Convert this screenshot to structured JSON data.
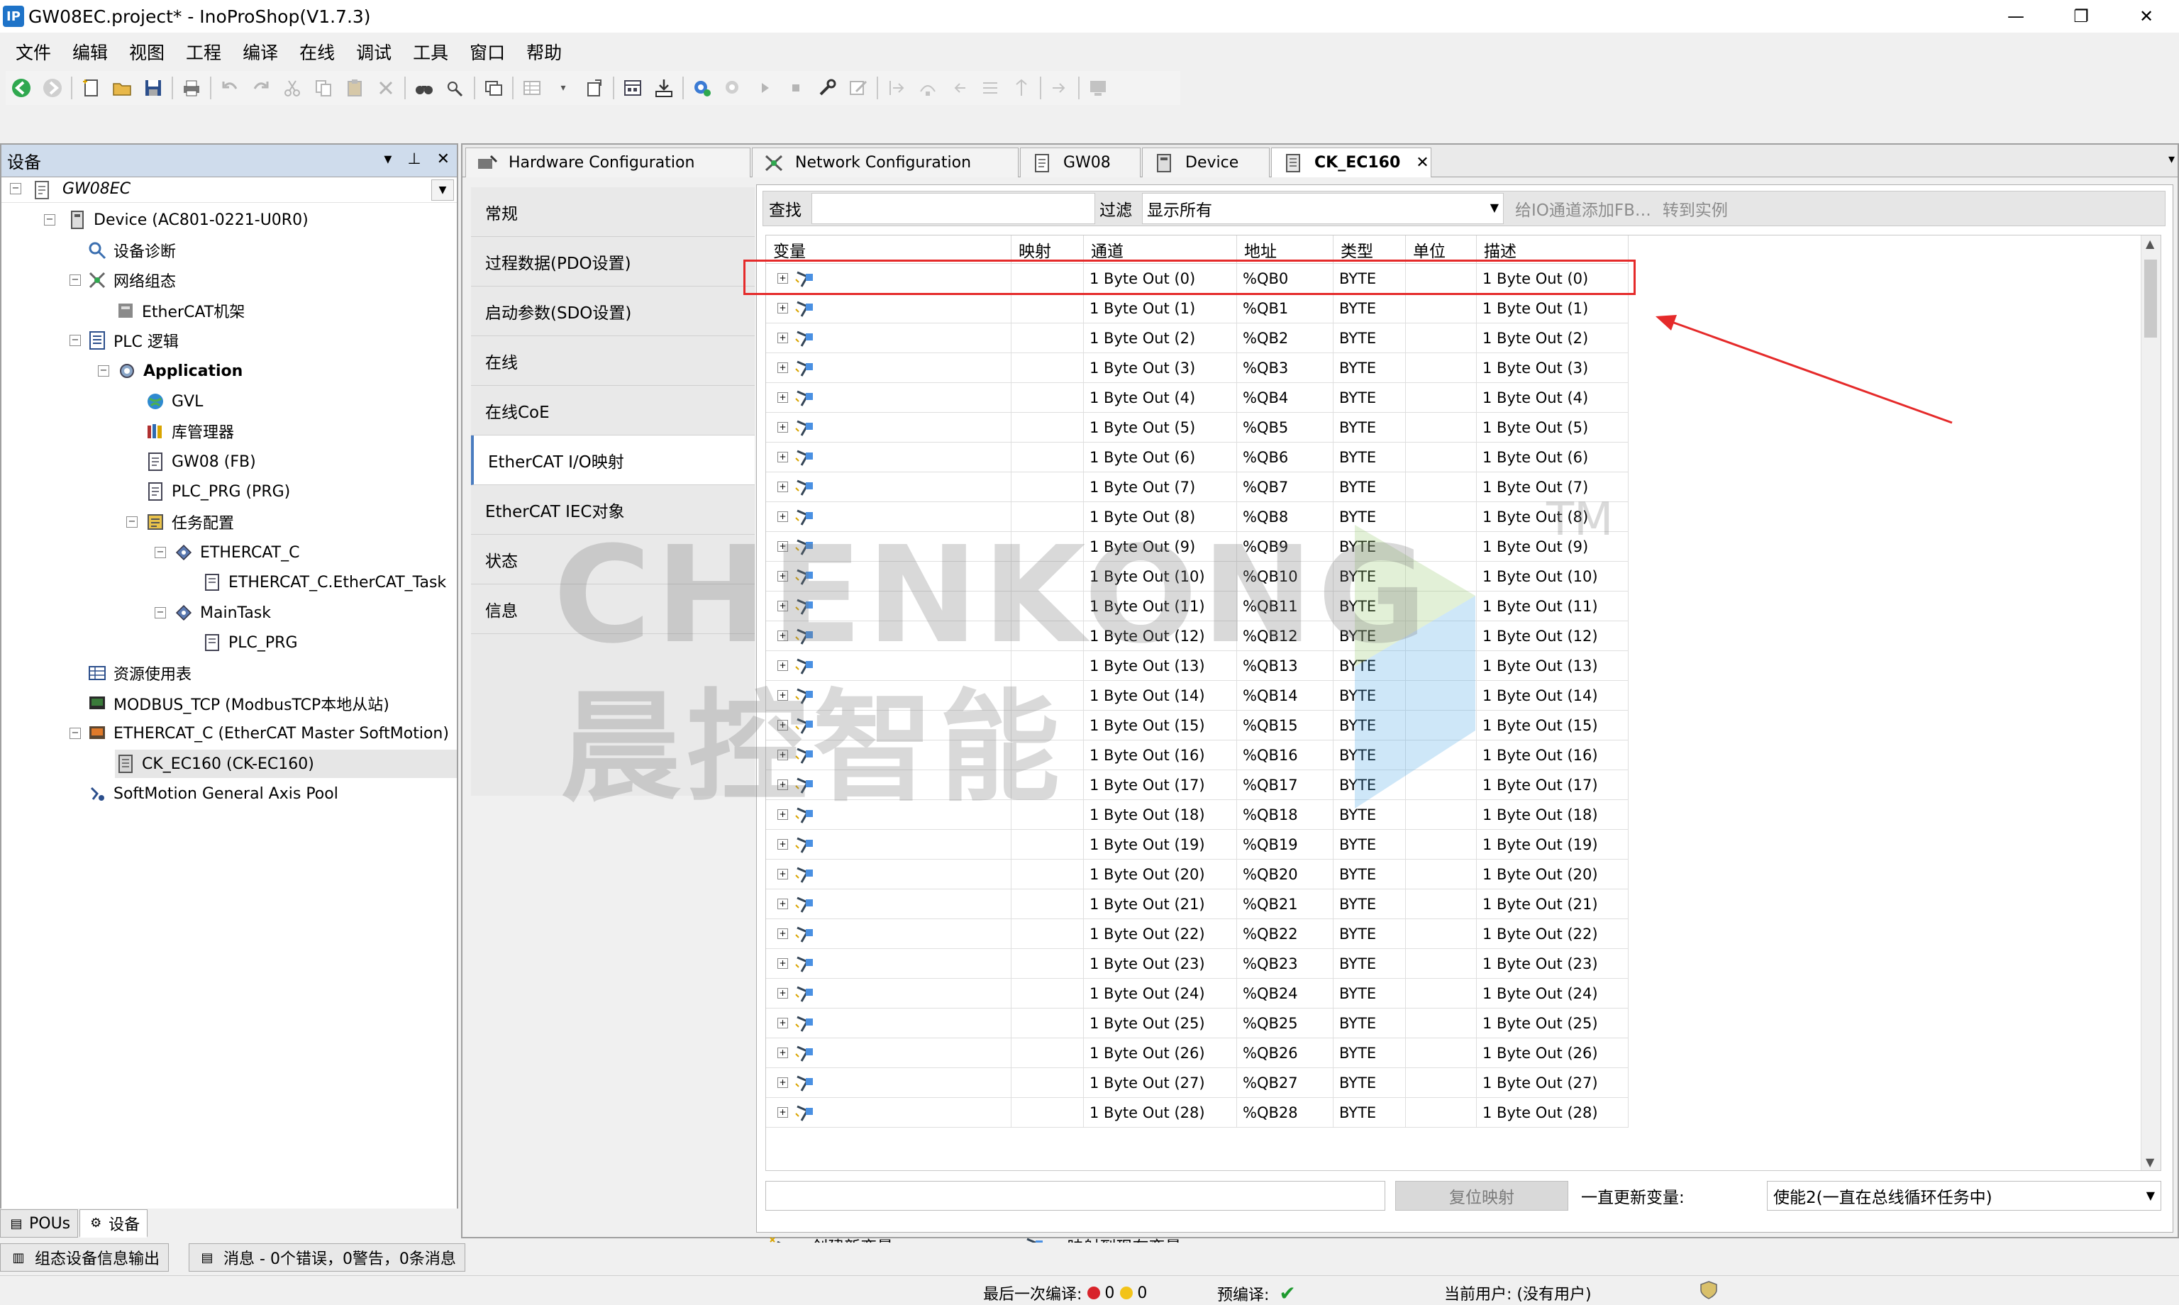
{
  "window": {
    "title": "GW08EC.project* - InoProShop(V1.7.3)",
    "app_icon_text": "IP",
    "controls": {
      "minimize": "—",
      "maximize": "❐",
      "close": "✕"
    }
  },
  "menubar": [
    "文件",
    "编辑",
    "视图",
    "工程",
    "编译",
    "在线",
    "调试",
    "工具",
    "窗口",
    "帮助"
  ],
  "left_panel": {
    "title": "设备",
    "controls": {
      "dropdown": "▾",
      "pin": "⊥",
      "close": "✕"
    },
    "root_label": "GW08EC",
    "tree": [
      {
        "label": "Device (AC801-0221-U0R0)",
        "icon": "device-icon"
      },
      {
        "label": "设备诊断",
        "icon": "diagnostics-icon"
      },
      {
        "label": "网络组态",
        "icon": "network-config-icon"
      },
      {
        "label": "EtherCAT机架",
        "icon": "rack-icon"
      },
      {
        "label": "PLC 逻辑",
        "icon": "plc-logic-icon"
      },
      {
        "label": "Application",
        "icon": "application-gear-icon"
      },
      {
        "label": "GVL",
        "icon": "globe-icon"
      },
      {
        "label": "库管理器",
        "icon": "library-icon"
      },
      {
        "label": "GW08 (FB)",
        "icon": "document-icon"
      },
      {
        "label": "PLC_PRG (PRG)",
        "icon": "document-icon"
      },
      {
        "label": "任务配置",
        "icon": "task-config-icon"
      },
      {
        "label": "ETHERCAT_C",
        "icon": "task-icon"
      },
      {
        "label": "ETHERCAT_C.EtherCAT_Task",
        "icon": "task-item-icon"
      },
      {
        "label": "MainTask",
        "icon": "task-icon"
      },
      {
        "label": "PLC_PRG",
        "icon": "task-item-icon"
      },
      {
        "label": "资源使用表",
        "icon": "table-icon"
      },
      {
        "label": "MODBUS_TCP (ModbusTCP本地从站)",
        "icon": "modbus-icon"
      },
      {
        "label": "ETHERCAT_C (EtherCAT Master SoftMotion)",
        "icon": "ethercat-master-icon"
      },
      {
        "label": "CK_EC160 (CK-EC160)",
        "icon": "module-icon"
      },
      {
        "label": "SoftMotion General Axis Pool",
        "icon": "axis-pool-icon"
      }
    ],
    "bottom_tabs": [
      "POUs",
      "设备"
    ]
  },
  "editor": {
    "tabs": [
      {
        "label": "Hardware Configuration",
        "icon": "hardware-icon"
      },
      {
        "label": "Network Configuration",
        "icon": "network-icon"
      },
      {
        "label": "GW08",
        "icon": "doc-icon"
      },
      {
        "label": "Device",
        "icon": "device-icon"
      },
      {
        "label": "CK_EC160",
        "icon": "module-icon",
        "close": "✕"
      }
    ],
    "tab_dropdown": "▾",
    "side_nav": [
      "常规",
      "过程数据(PDO设置)",
      "启动参数(SDO设置)",
      "在线",
      "在线CoE",
      "EtherCAT I/O映射",
      "EtherCAT IEC对象",
      "状态",
      "信息"
    ],
    "side_nav_active": "EtherCAT I/O映射",
    "filter": {
      "find_label": "查找",
      "filter_label": "过滤",
      "filter_value": "显示所有",
      "add_fb": "给IO通道添加FB…",
      "goto_instance": "转到实例"
    },
    "columns": [
      "变量",
      "映射",
      "通道",
      "地址",
      "类型",
      "单位",
      "描述"
    ],
    "rows": [
      {
        "channel": "1 Byte Out (0)",
        "address": "%QB0",
        "type": "BYTE",
        "desc": "1 Byte Out (0)"
      },
      {
        "channel": "1 Byte Out (1)",
        "address": "%QB1",
        "type": "BYTE",
        "desc": "1 Byte Out (1)"
      },
      {
        "channel": "1 Byte Out (2)",
        "address": "%QB2",
        "type": "BYTE",
        "desc": "1 Byte Out (2)"
      },
      {
        "channel": "1 Byte Out (3)",
        "address": "%QB3",
        "type": "BYTE",
        "desc": "1 Byte Out (3)"
      },
      {
        "channel": "1 Byte Out (4)",
        "address": "%QB4",
        "type": "BYTE",
        "desc": "1 Byte Out (4)"
      },
      {
        "channel": "1 Byte Out (5)",
        "address": "%QB5",
        "type": "BYTE",
        "desc": "1 Byte Out (5)"
      },
      {
        "channel": "1 Byte Out (6)",
        "address": "%QB6",
        "type": "BYTE",
        "desc": "1 Byte Out (6)"
      },
      {
        "channel": "1 Byte Out (7)",
        "address": "%QB7",
        "type": "BYTE",
        "desc": "1 Byte Out (7)"
      },
      {
        "channel": "1 Byte Out (8)",
        "address": "%QB8",
        "type": "BYTE",
        "desc": "1 Byte Out (8)"
      },
      {
        "channel": "1 Byte Out (9)",
        "address": "%QB9",
        "type": "BYTE",
        "desc": "1 Byte Out (9)"
      },
      {
        "channel": "1 Byte Out (10)",
        "address": "%QB10",
        "type": "BYTE",
        "desc": "1 Byte Out (10)"
      },
      {
        "channel": "1 Byte Out (11)",
        "address": "%QB11",
        "type": "BYTE",
        "desc": "1 Byte Out (11)"
      },
      {
        "channel": "1 Byte Out (12)",
        "address": "%QB12",
        "type": "BYTE",
        "desc": "1 Byte Out (12)"
      },
      {
        "channel": "1 Byte Out (13)",
        "address": "%QB13",
        "type": "BYTE",
        "desc": "1 Byte Out (13)"
      },
      {
        "channel": "1 Byte Out (14)",
        "address": "%QB14",
        "type": "BYTE",
        "desc": "1 Byte Out (14)"
      },
      {
        "channel": "1 Byte Out (15)",
        "address": "%QB15",
        "type": "BYTE",
        "desc": "1 Byte Out (15)"
      },
      {
        "channel": "1 Byte Out (16)",
        "address": "%QB16",
        "type": "BYTE",
        "desc": "1 Byte Out (16)"
      },
      {
        "channel": "1 Byte Out (17)",
        "address": "%QB17",
        "type": "BYTE",
        "desc": "1 Byte Out (17)"
      },
      {
        "channel": "1 Byte Out (18)",
        "address": "%QB18",
        "type": "BYTE",
        "desc": "1 Byte Out (18)"
      },
      {
        "channel": "1 Byte Out (19)",
        "address": "%QB19",
        "type": "BYTE",
        "desc": "1 Byte Out (19)"
      },
      {
        "channel": "1 Byte Out (20)",
        "address": "%QB20",
        "type": "BYTE",
        "desc": "1 Byte Out (20)"
      },
      {
        "channel": "1 Byte Out (21)",
        "address": "%QB21",
        "type": "BYTE",
        "desc": "1 Byte Out (21)"
      },
      {
        "channel": "1 Byte Out (22)",
        "address": "%QB22",
        "type": "BYTE",
        "desc": "1 Byte Out (22)"
      },
      {
        "channel": "1 Byte Out (23)",
        "address": "%QB23",
        "type": "BYTE",
        "desc": "1 Byte Out (23)"
      },
      {
        "channel": "1 Byte Out (24)",
        "address": "%QB24",
        "type": "BYTE",
        "desc": "1 Byte Out (24)"
      },
      {
        "channel": "1 Byte Out (25)",
        "address": "%QB25",
        "type": "BYTE",
        "desc": "1 Byte Out (25)"
      },
      {
        "channel": "1 Byte Out (26)",
        "address": "%QB26",
        "type": "BYTE",
        "desc": "1 Byte Out (26)"
      },
      {
        "channel": "1 Byte Out (27)",
        "address": "%QB27",
        "type": "BYTE",
        "desc": "1 Byte Out (27)"
      },
      {
        "channel": "1 Byte Out (28)",
        "address": "%QB28",
        "type": "BYTE",
        "desc": "1 Byte Out (28)"
      }
    ],
    "bottom": {
      "reset_mapping": "复位映射",
      "always_update_label": "一直更新变量:",
      "always_update_value": "使能2(一直在总线循环任务中)"
    },
    "legend": {
      "create_var": "=创建新变量",
      "map_existing": "=映射到现有变量"
    }
  },
  "message_tabs": [
    "组态设备信息输出",
    "消息 - 0个错误，0警告，0条消息"
  ],
  "statusbar": {
    "last_build_label": "最后一次编译:",
    "errors": "0",
    "warnings": "0",
    "precompile_label": "预编译:",
    "precompile_ok": "✔",
    "current_user": "当前用户: (没有用户)"
  },
  "watermark": {
    "latin": "CHENKONG",
    "cjk": "晨控智能",
    "tm": "TM"
  },
  "colors": {
    "highlight": "#e52a2a",
    "panel_header": "#cfdcec",
    "active_nav": "#4a7cc0",
    "error_dot": "#d8232a",
    "warning_dot": "#f2c318",
    "check": "#1e9a2e"
  }
}
